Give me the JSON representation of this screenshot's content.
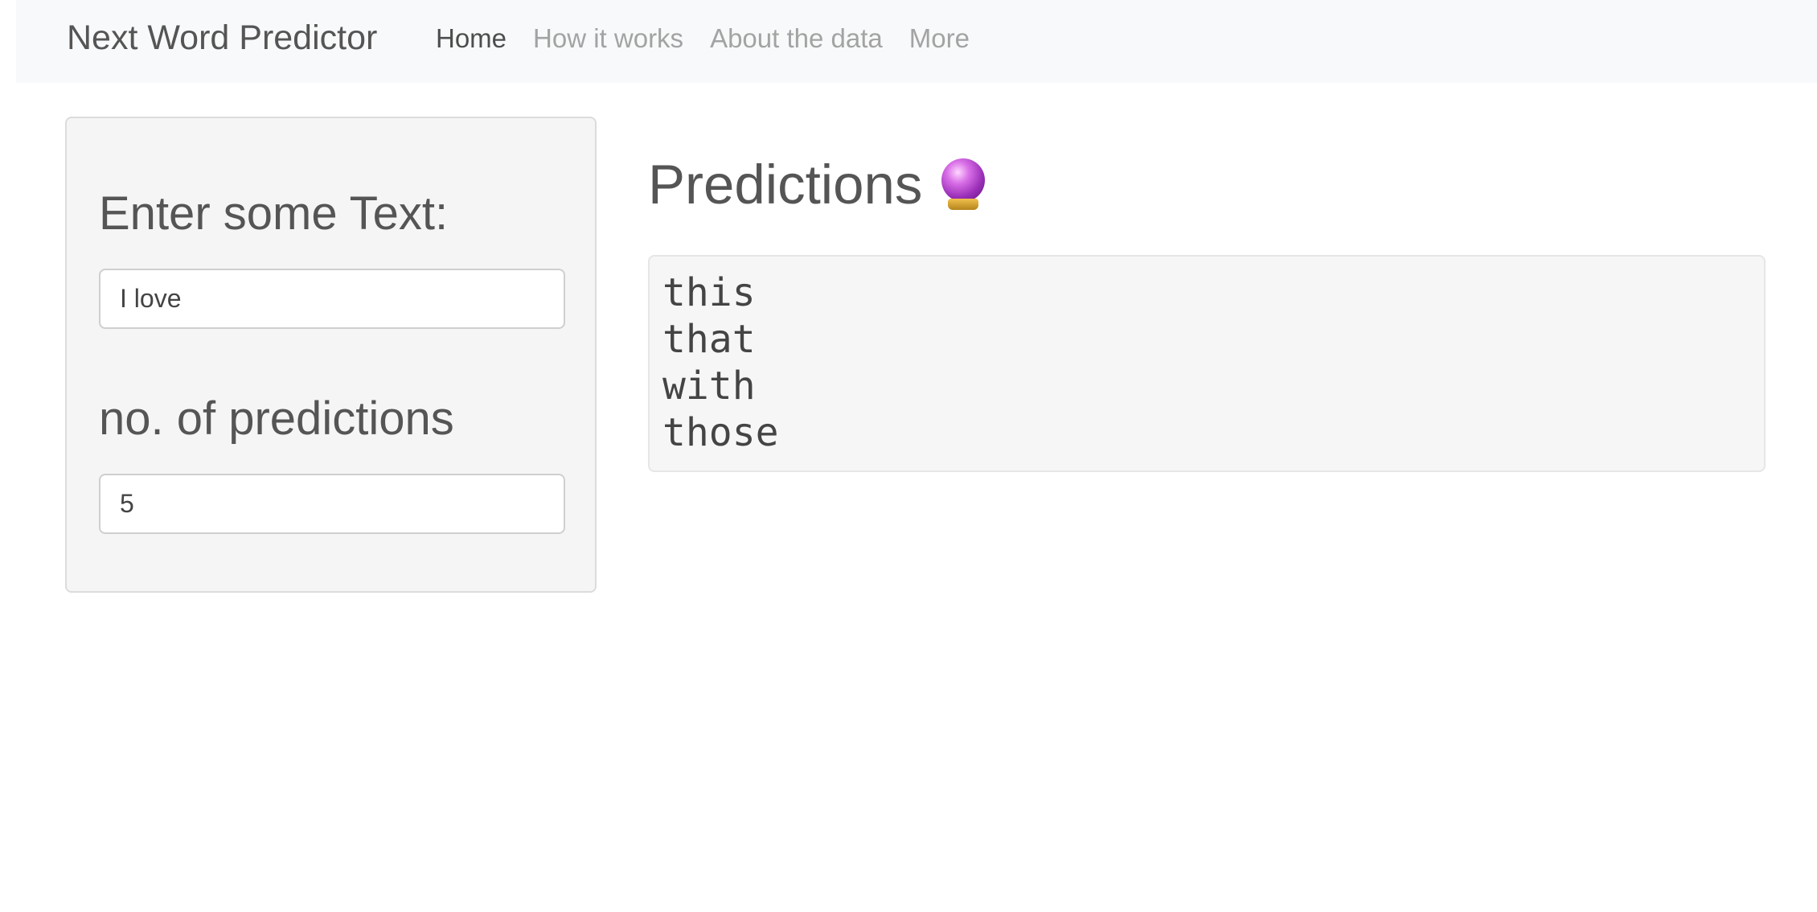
{
  "navbar": {
    "brand": "Next Word Predictor",
    "links": [
      {
        "label": "Home",
        "active": true
      },
      {
        "label": "How it works",
        "active": false
      },
      {
        "label": "About the data",
        "active": false
      },
      {
        "label": "More",
        "active": false
      }
    ]
  },
  "sidebar": {
    "text_label": "Enter some Text:",
    "text_value": "I love",
    "count_label": "no. of predictions",
    "count_value": "5"
  },
  "main": {
    "title": "Predictions",
    "title_icon": "crystal-ball-icon",
    "predictions": [
      "this",
      "that",
      "with",
      "those"
    ]
  }
}
